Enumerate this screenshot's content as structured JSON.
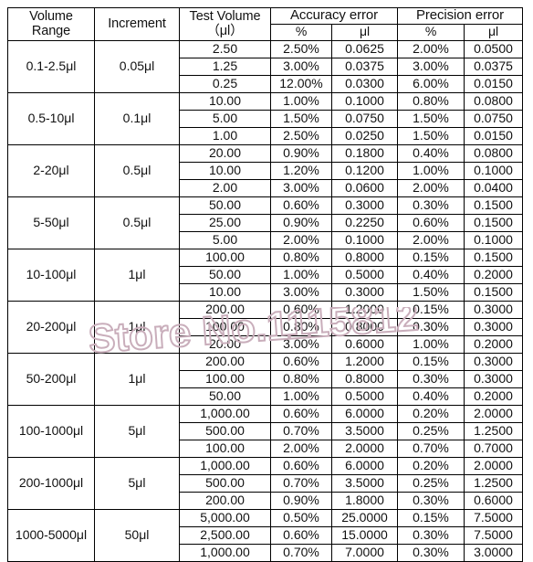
{
  "table": {
    "headers": {
      "volume_range": "Volume Range",
      "volume_range_line1": "Volume",
      "volume_range_line2": "Range",
      "increment": "Increment",
      "test_volume_line1": "Test Volume",
      "test_volume_line2": "（μl）",
      "accuracy_error": "Accuracy error",
      "precision_error": "Precision error",
      "accuracy_percent": "%",
      "accuracy_ul": "μl",
      "precision_percent": "%",
      "precision_ul": "μl"
    },
    "groups": [
      {
        "volume_range": "0.1-2.5μl",
        "increment": "0.05μl",
        "rows": [
          {
            "test_volume": "2.50",
            "accuracy_percent": "2.50%",
            "accuracy_ul": "0.0625",
            "precision_percent": "2.00%",
            "precision_ul": "0.0500"
          },
          {
            "test_volume": "1.25",
            "accuracy_percent": "3.00%",
            "accuracy_ul": "0.0375",
            "precision_percent": "3.00%",
            "precision_ul": "0.0375"
          },
          {
            "test_volume": "0.25",
            "accuracy_percent": "12.00%",
            "accuracy_ul": "0.0300",
            "precision_percent": "6.00%",
            "precision_ul": "0.0150"
          }
        ]
      },
      {
        "volume_range": "0.5-10μl",
        "increment": "0.1μl",
        "rows": [
          {
            "test_volume": "10.00",
            "accuracy_percent": "1.00%",
            "accuracy_ul": "0.1000",
            "precision_percent": "0.80%",
            "precision_ul": "0.0800"
          },
          {
            "test_volume": "5.00",
            "accuracy_percent": "1.50%",
            "accuracy_ul": "0.0750",
            "precision_percent": "1.50%",
            "precision_ul": "0.0750"
          },
          {
            "test_volume": "1.00",
            "accuracy_percent": "2.50%",
            "accuracy_ul": "0.0250",
            "precision_percent": "1.50%",
            "precision_ul": "0.0150"
          }
        ]
      },
      {
        "volume_range": "2-20μl",
        "increment": "0.5μl",
        "rows": [
          {
            "test_volume": "20.00",
            "accuracy_percent": "0.90%",
            "accuracy_ul": "0.1800",
            "precision_percent": "0.40%",
            "precision_ul": "0.0800"
          },
          {
            "test_volume": "10.00",
            "accuracy_percent": "1.20%",
            "accuracy_ul": "0.1200",
            "precision_percent": "1.00%",
            "precision_ul": "0.1000"
          },
          {
            "test_volume": "2.00",
            "accuracy_percent": "3.00%",
            "accuracy_ul": "0.0600",
            "precision_percent": "2.00%",
            "precision_ul": "0.0400"
          }
        ]
      },
      {
        "volume_range": "5-50μl",
        "increment": "0.5μl",
        "rows": [
          {
            "test_volume": "50.00",
            "accuracy_percent": "0.60%",
            "accuracy_ul": "0.3000",
            "precision_percent": "0.30%",
            "precision_ul": "0.1500"
          },
          {
            "test_volume": "25.00",
            "accuracy_percent": "0.90%",
            "accuracy_ul": "0.2250",
            "precision_percent": "0.60%",
            "precision_ul": "0.1500"
          },
          {
            "test_volume": "5.00",
            "accuracy_percent": "2.00%",
            "accuracy_ul": "0.1000",
            "precision_percent": "2.00%",
            "precision_ul": "0.1000"
          }
        ]
      },
      {
        "volume_range": "10-100μl",
        "increment": "1μl",
        "rows": [
          {
            "test_volume": "100.00",
            "accuracy_percent": "0.80%",
            "accuracy_ul": "0.8000",
            "precision_percent": "0.15%",
            "precision_ul": "0.1500"
          },
          {
            "test_volume": "50.00",
            "accuracy_percent": "1.00%",
            "accuracy_ul": "0.5000",
            "precision_percent": "0.40%",
            "precision_ul": "0.2000"
          },
          {
            "test_volume": "10.00",
            "accuracy_percent": "3.00%",
            "accuracy_ul": "0.3000",
            "precision_percent": "1.50%",
            "precision_ul": "0.1500"
          }
        ]
      },
      {
        "volume_range": "20-200μl",
        "increment": "1μl",
        "rows": [
          {
            "test_volume": "200.00",
            "accuracy_percent": "0.60%",
            "accuracy_ul": "1.2000",
            "precision_percent": "0.15%",
            "precision_ul": "0.3000"
          },
          {
            "test_volume": "100.00",
            "accuracy_percent": "0.80%",
            "accuracy_ul": "0.8000",
            "precision_percent": "0.30%",
            "precision_ul": "0.3000"
          },
          {
            "test_volume": "20.00",
            "accuracy_percent": "3.00%",
            "accuracy_ul": "0.6000",
            "precision_percent": "1.00%",
            "precision_ul": "0.2000"
          }
        ]
      },
      {
        "volume_range": "50-200μl",
        "increment": "1μl",
        "rows": [
          {
            "test_volume": "200.00",
            "accuracy_percent": "0.60%",
            "accuracy_ul": "1.2000",
            "precision_percent": "0.15%",
            "precision_ul": "0.3000"
          },
          {
            "test_volume": "100.00",
            "accuracy_percent": "0.80%",
            "accuracy_ul": "0.8000",
            "precision_percent": "0.30%",
            "precision_ul": "0.3000"
          },
          {
            "test_volume": "50.00",
            "accuracy_percent": "1.00%",
            "accuracy_ul": "0.5000",
            "precision_percent": "0.40%",
            "precision_ul": "0.2000"
          }
        ]
      },
      {
        "volume_range": "100-1000μl",
        "increment": "5μl",
        "rows": [
          {
            "test_volume": "1,000.00",
            "accuracy_percent": "0.60%",
            "accuracy_ul": "6.0000",
            "precision_percent": "0.20%",
            "precision_ul": "2.0000"
          },
          {
            "test_volume": "500.00",
            "accuracy_percent": "0.70%",
            "accuracy_ul": "3.5000",
            "precision_percent": "0.25%",
            "precision_ul": "1.2500"
          },
          {
            "test_volume": "100.00",
            "accuracy_percent": "2.00%",
            "accuracy_ul": "2.0000",
            "precision_percent": "0.70%",
            "precision_ul": "0.7000"
          }
        ]
      },
      {
        "volume_range": "200-1000μl",
        "increment": "5μl",
        "rows": [
          {
            "test_volume": "1,000.00",
            "accuracy_percent": "0.60%",
            "accuracy_ul": "6.0000",
            "precision_percent": "0.20%",
            "precision_ul": "2.0000"
          },
          {
            "test_volume": "500.00",
            "accuracy_percent": "0.70%",
            "accuracy_ul": "3.5000",
            "precision_percent": "0.25%",
            "precision_ul": "1.2500"
          },
          {
            "test_volume": "200.00",
            "accuracy_percent": "0.90%",
            "accuracy_ul": "1.8000",
            "precision_percent": "0.30%",
            "precision_ul": "0.6000"
          }
        ]
      },
      {
        "volume_range": "1000-5000μl",
        "increment": "50μl",
        "rows": [
          {
            "test_volume": "5,000.00",
            "accuracy_percent": "0.50%",
            "accuracy_ul": "25.0000",
            "precision_percent": "0.15%",
            "precision_ul": "7.5000"
          },
          {
            "test_volume": "2,500.00",
            "accuracy_percent": "0.60%",
            "accuracy_ul": "15.0000",
            "precision_percent": "0.30%",
            "precision_ul": "7.5000"
          },
          {
            "test_volume": "1,000.00",
            "accuracy_percent": "0.70%",
            "accuracy_ul": "7.0000",
            "precision_percent": "0.30%",
            "precision_ul": "3.0000"
          }
        ]
      }
    ]
  },
  "watermark": {
    "text": "Store No.1115812",
    "color": "#c9aebb"
  }
}
